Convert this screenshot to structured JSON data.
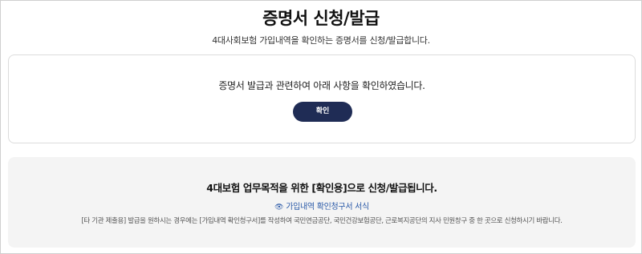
{
  "page": {
    "title": "증명서 신청/발급",
    "subtitle": "4대사회보험 가입내역을 확인하는 증명서를 신청/발급합니다."
  },
  "confirm_card": {
    "message": "증명서 발급과 관련하여 아래 사항을 확인하였습니다.",
    "button_label": "확인",
    "button_color": "#1f2c55"
  },
  "info_card": {
    "heading": "4대보험 업무목적을 위한 [확인용]으로 신청/발급됩니다.",
    "link_icon": "eye-icon",
    "link_label": "가입내역 확인청구서 서식",
    "note": "[타 기관 제출용] 발급을 원하시는 경우에는 [가입내역 확인청구서]를 작성하여 국민연금공단, 국민건강보험공단, 근로복지공단의 지사 민원창구 중 한 곳으로 신청하시기 바랍니다.",
    "link_color": "#2b5aa8"
  }
}
